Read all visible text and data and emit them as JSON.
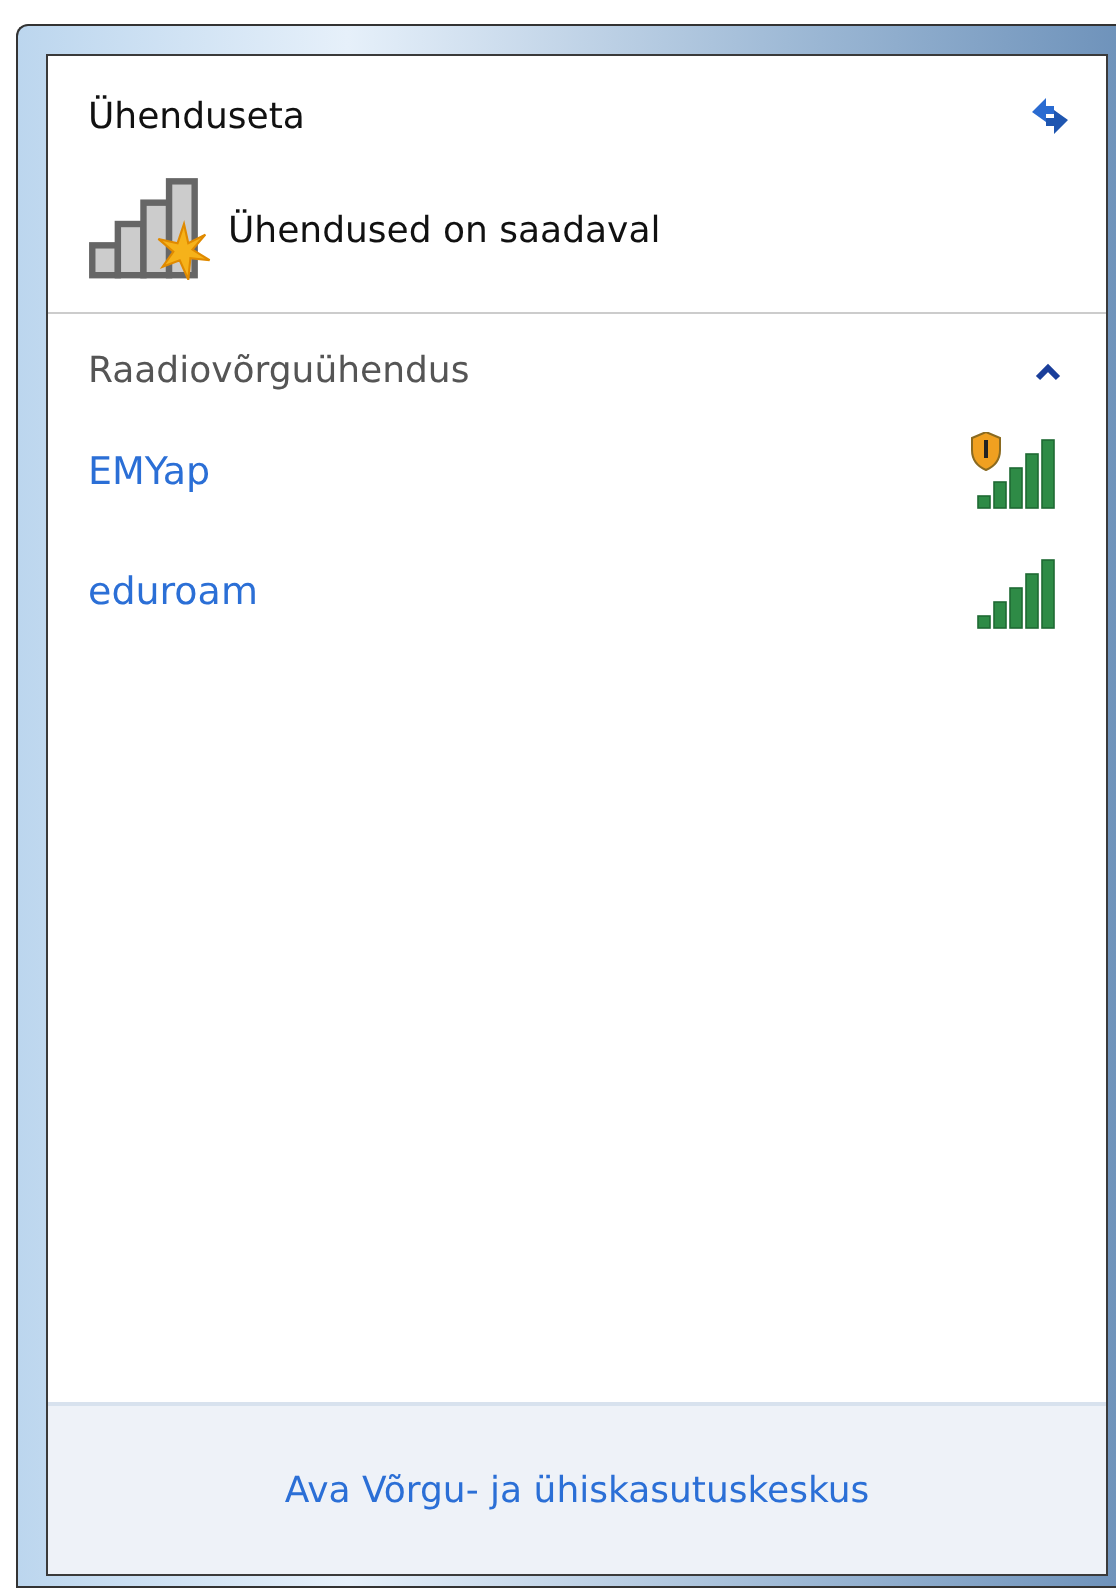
{
  "header": {
    "title": "Ühenduseta",
    "status": "Ühendused on saadaval"
  },
  "section": {
    "title": "Raadiovõrguühendus",
    "expanded": true
  },
  "networks": [
    {
      "name": "EMYap",
      "secured": true
    },
    {
      "name": "eduroam",
      "secured": false
    }
  ],
  "footer": {
    "link": "Ava Võrgu- ja ühiskasutuskeskus"
  }
}
